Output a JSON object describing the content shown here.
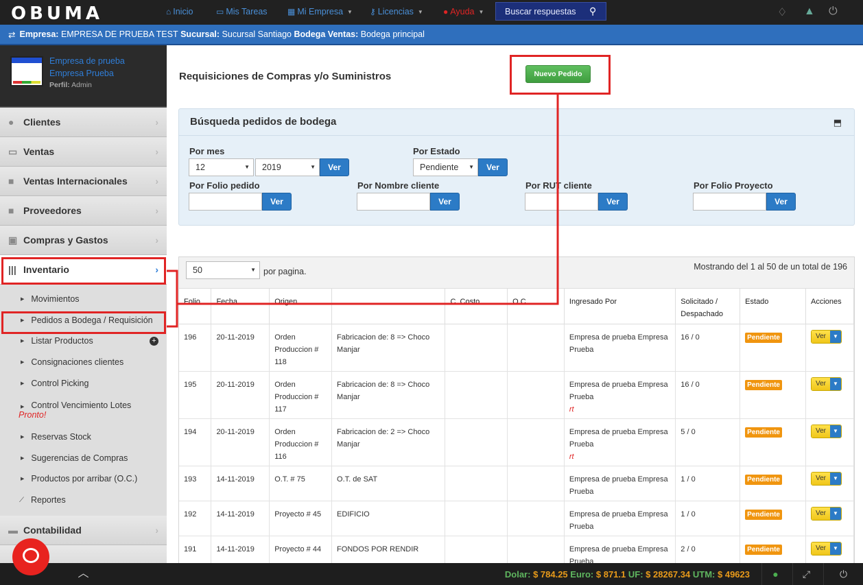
{
  "topbar": {
    "logo": "OBUMA",
    "nav": {
      "inicio": "Inicio",
      "tareas": "Mis Tareas",
      "empresa": "Mi Empresa",
      "licencias": "Licencias",
      "ayuda": "Ayuda"
    },
    "search_placeholder": "Buscar respuestas"
  },
  "context": {
    "empresa_label": "Empresa:",
    "empresa": "EMPRESA DE PRUEBA TEST",
    "sucursal_label": "Sucursal:",
    "sucursal": "Sucursal Santiago",
    "bodega_label": "Bodega Ventas:",
    "bodega": "Bodega principal"
  },
  "profile": {
    "line1": "Empresa de prueba",
    "line2": "Empresa Prueba",
    "perfil_label": "Perfil:",
    "perfil": "Admin"
  },
  "sidebar": {
    "items": [
      {
        "label": "Clientes",
        "icon": "users-icon"
      },
      {
        "label": "Ventas",
        "icon": "money-icon"
      },
      {
        "label": "Ventas Internacionales",
        "icon": "truck-icon"
      },
      {
        "label": "Proveedores",
        "icon": "truck-icon"
      },
      {
        "label": "Compras y Gastos",
        "icon": "receipt-icon"
      },
      {
        "label": "Inventario",
        "icon": "barcode-icon"
      }
    ],
    "submenu": [
      "Movimientos",
      "Pedidos a Bodega / Requisición",
      "Listar Productos",
      "Consignaciones clientes",
      "Control Picking",
      "Control Vencimiento Lotes",
      "Reservas Stock",
      "Sugerencias de Compras",
      "Productos por arribar (O.C.)",
      "Reportes"
    ],
    "pronto": "Pronto!",
    "contabilidad": "Contabilidad"
  },
  "main": {
    "title": "Requisiciones de Compras y/o Suministros",
    "nuevo_pedido": "Nuevo Pedido",
    "search": {
      "title": "Búsqueda pedidos de bodega",
      "por_mes": "Por mes",
      "mes_value": "12",
      "anio_value": "2019",
      "por_estado": "Por Estado",
      "estado_value": "Pendiente",
      "por_folio": "Por Folio pedido",
      "por_nombre": "Por Nombre cliente",
      "por_rut": "Por RUT cliente",
      "por_proyecto": "Por Folio Proyecto",
      "ver": "Ver"
    },
    "table": {
      "perpage_value": "50",
      "perpage_label": "por pagina.",
      "showing": "Mostrando del 1 al 50 de un total de 196",
      "headers": [
        "Folio",
        "Fecha",
        "Origen",
        "",
        "C. Costo",
        "O.C.",
        "Ingresado Por",
        "Solicitado / Despachado",
        "Estado",
        "Acciones"
      ],
      "rows": [
        {
          "folio": "196",
          "fecha": "20-11-2019",
          "origen": "Orden Produccion # 118",
          "detalle": "Fabricacion de: 8 => Choco Manjar",
          "ingresado": "Empresa de prueba Empresa Prueba",
          "note": "",
          "cant": "16 / 0",
          "estado": "Pendiente"
        },
        {
          "folio": "195",
          "fecha": "20-11-2019",
          "origen": "Orden Produccion # 117",
          "detalle": "Fabricacion de: 8 => Choco Manjar",
          "ingresado": "Empresa de prueba Empresa Prueba",
          "note": "rt",
          "cant": "16 / 0",
          "estado": "Pendiente"
        },
        {
          "folio": "194",
          "fecha": "20-11-2019",
          "origen": "Orden Produccion # 116",
          "detalle": "Fabricacion de: 2 => Choco Manjar",
          "ingresado": "Empresa de prueba Empresa Prueba",
          "note": "rt",
          "cant": "5 / 0",
          "estado": "Pendiente"
        },
        {
          "folio": "193",
          "fecha": "14-11-2019",
          "origen": "O.T. # 75",
          "detalle": "O.T. de SAT",
          "ingresado": "Empresa de prueba Empresa Prueba",
          "note": "",
          "cant": "1 / 0",
          "estado": "Pendiente"
        },
        {
          "folio": "192",
          "fecha": "14-11-2019",
          "origen": "Proyecto # 45",
          "detalle": "EDIFICIO",
          "ingresado": "Empresa de prueba Empresa Prueba",
          "note": "",
          "cant": "1 / 0",
          "estado": "Pendiente"
        },
        {
          "folio": "191",
          "fecha": "14-11-2019",
          "origen": "Proyecto # 44",
          "detalle": "FONDOS POR RENDIR",
          "ingresado": "Empresa de prueba Empresa Prueba",
          "note": "",
          "cant": "2 / 0",
          "estado": "Pendiente"
        }
      ],
      "ver_label": "Ver"
    }
  },
  "bottombar": {
    "dolar_label": "Dolar:",
    "dolar": "$ 784.25",
    "euro_label": "Euro:",
    "euro": "$ 871.1",
    "uf_label": "UF:",
    "uf": "$ 28267.34",
    "utm_label": "UTM:",
    "utm": "$ 49623"
  },
  "colors": {
    "accent": "#2c7bc6",
    "highlight": "#e02424",
    "badge": "#f0950f",
    "success": "#4cae4c"
  }
}
